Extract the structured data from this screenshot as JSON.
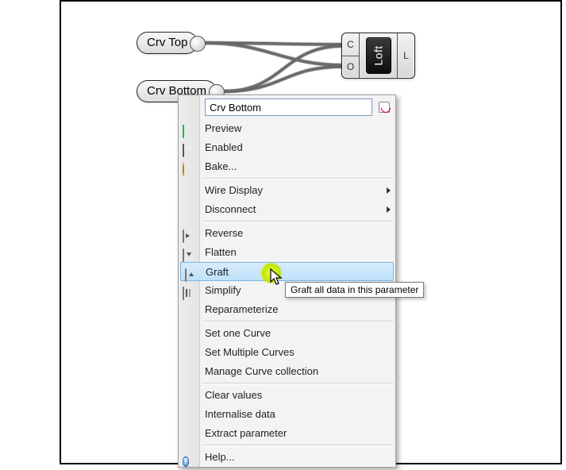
{
  "params": {
    "top": {
      "label": "Crv Top"
    },
    "bottom": {
      "label": "Crv Bottom"
    }
  },
  "component": {
    "name": "Loft",
    "inputs": [
      "C",
      "O"
    ],
    "outputs": [
      "L"
    ]
  },
  "menu": {
    "title_value": "Crv Bottom",
    "items": {
      "preview": "Preview",
      "enabled": "Enabled",
      "bake": "Bake...",
      "wire_display": "Wire Display",
      "disconnect": "Disconnect",
      "reverse": "Reverse",
      "flatten": "Flatten",
      "graft": "Graft",
      "simplify": "Simplify",
      "reparam": "Reparameterize",
      "set_one": "Set one Curve",
      "set_multiple": "Set Multiple Curves",
      "manage": "Manage Curve collection",
      "clear": "Clear values",
      "internalise": "Internalise data",
      "extract": "Extract parameter",
      "help": "Help..."
    }
  },
  "tooltip": "Graft all data in this parameter"
}
